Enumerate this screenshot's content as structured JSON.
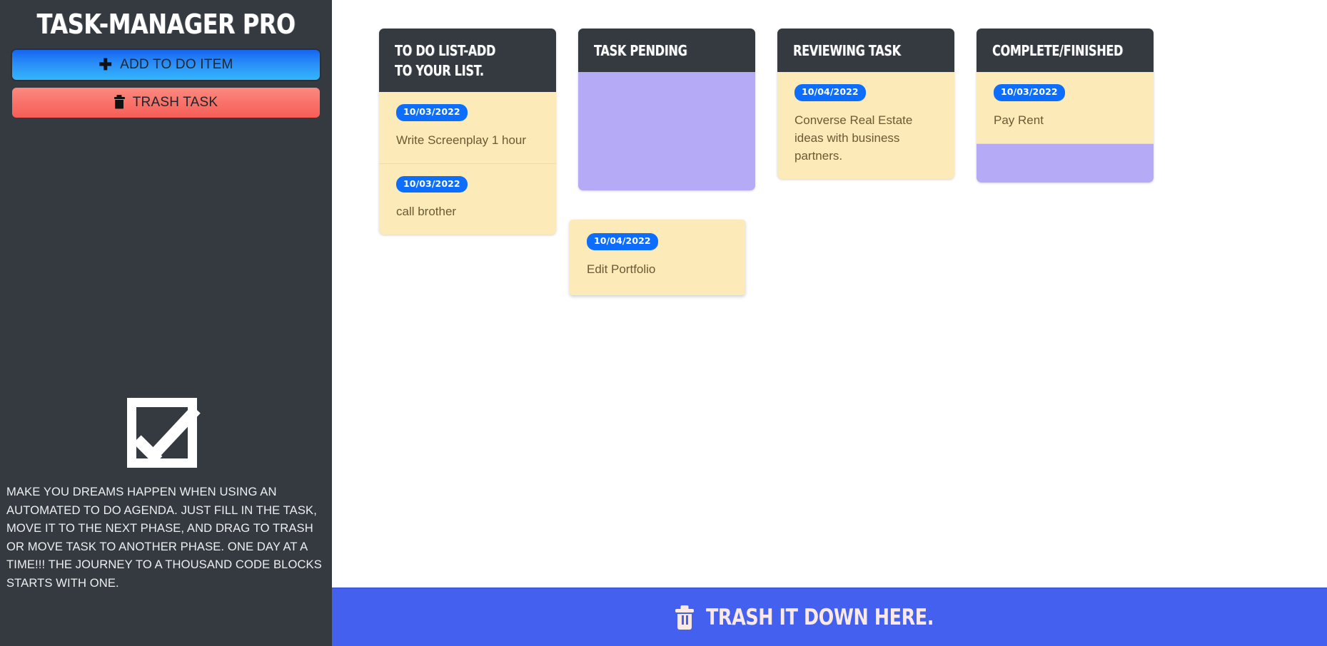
{
  "sidebar": {
    "brand": "TASK-MANAGER PRO",
    "add_button": "ADD TO DO ITEM",
    "trash_button": "TRASH TASK",
    "plus_icon": "plus-icon",
    "trash_icon": "trash-icon",
    "illustration_icon": "checked-checkbox-icon",
    "description": "MAKE YOU DREAMS HAPPEN WHEN USING AN AUTOMATED TO DO AGENDA. JUST FILL IN THE TASK, MOVE IT TO THE NEXT PHASE, AND DRAG TO TRASH OR MOVE TASK TO ANOTHER PHASE. ONE DAY AT A TIME!!! THE JOURNEY TO A THOUSAND CODE BLOCKS STARTS WITH ONE.",
    "colors": {
      "background": "#343a40",
      "add_button_gradient_start": "#1565f0",
      "add_button_gradient_end": "#33b6fb",
      "trash_button_gradient_start": "#fb8a80",
      "trash_button_gradient_end": "#f65e57"
    }
  },
  "board": {
    "columns": [
      {
        "title": "TO DO LIST-ADD TO YOUR LIST.",
        "cards": [
          {
            "date": "10/03/2022",
            "text": "Write Screenplay 1 hour"
          },
          {
            "date": "10/03/2022",
            "text": "call brother"
          }
        ],
        "dropzone": false
      },
      {
        "title": "TASK PENDING",
        "cards": [],
        "dropzone": true
      },
      {
        "title": "REVIEWING TASK",
        "cards": [
          {
            "date": "10/04/2022",
            "text": "Converse Real Estate ideas with business partners."
          }
        ],
        "dropzone": false
      },
      {
        "title": "COMPLETE/FINISHED",
        "cards": [
          {
            "date": "10/03/2022",
            "text": "Pay Rent"
          }
        ],
        "dropzone": true
      }
    ],
    "dragging_card": {
      "date": "10/04/2022",
      "text": "Edit Portfolio"
    },
    "colors": {
      "card_background": "#fceab8",
      "dropzone": "#b4aaf5",
      "header_background": "#343a40",
      "date_pill": "#0d6efd",
      "card_text": "#6b5a33"
    }
  },
  "trash_bar": {
    "label": "TRASH IT DOWN HERE.",
    "icon": "trash-icon",
    "color": "#4361ee"
  }
}
